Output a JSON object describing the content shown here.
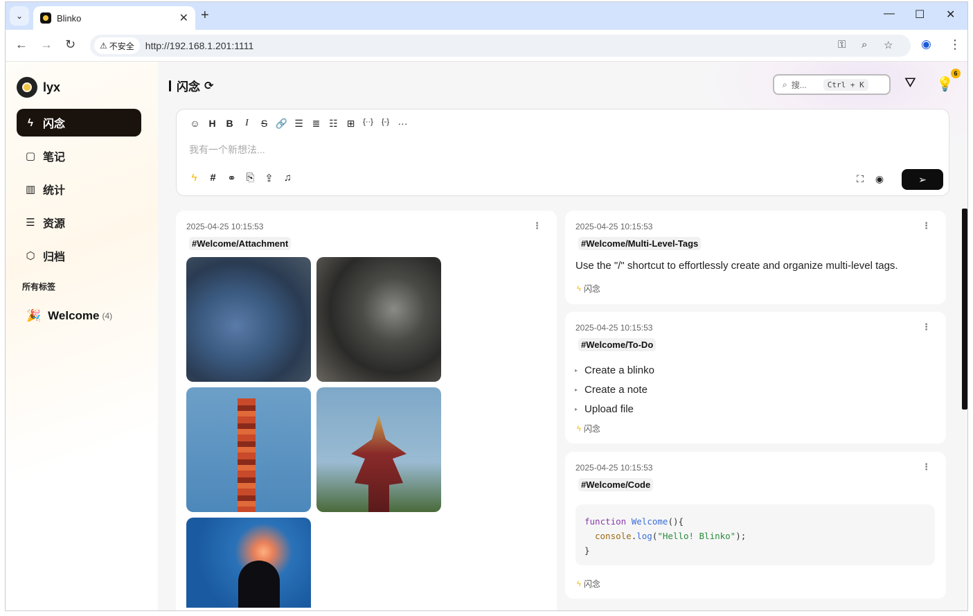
{
  "browser": {
    "tab_title": "Blinko",
    "insecure_label": "不安全",
    "url": "http://192.168.1.201:1111"
  },
  "sidebar": {
    "username": "lyx",
    "items": [
      {
        "label": "闪念",
        "icon": "flash-icon"
      },
      {
        "label": "笔记",
        "icon": "note-icon"
      },
      {
        "label": "统计",
        "icon": "chart-icon"
      },
      {
        "label": "资源",
        "icon": "database-icon"
      },
      {
        "label": "归档",
        "icon": "archive-box-icon"
      }
    ],
    "tags_title": "所有标签",
    "tag": {
      "name": "Welcome",
      "count": "(4)"
    }
  },
  "header": {
    "title": "闪念",
    "search_placeholder": "搜...",
    "shortcut_ctrl": "Ctrl",
    "shortcut_plus": "+",
    "shortcut_key": "K",
    "notification_count": "6"
  },
  "editor": {
    "placeholder": "我有一个新想法..."
  },
  "notes": [
    {
      "time": "2025-04-25 10:15:53",
      "tag": "#Welcome/Attachment"
    },
    {
      "time": "2025-04-25 10:15:53",
      "tag": "#Welcome/Multi-Level-Tags",
      "text": "Use the \"/\" shortcut to effortlessly create and organize multi-level tags.",
      "footer": "闪念"
    },
    {
      "time": "2025-04-25 10:15:53",
      "tag": "#Welcome/To-Do",
      "items": [
        "Create a blinko",
        "Create a note",
        "Upload file"
      ],
      "footer": "闪念"
    },
    {
      "time": "2025-04-25 10:15:53",
      "tag": "#Welcome/Code",
      "code": {
        "line1_kw": "function",
        "line1_fn": "Welcome",
        "line1_rest": "(){",
        "line2_obj": "console",
        "line2_dot": ".",
        "line2_fn": "log",
        "line2_open": "(",
        "line2_str": "\"Hello! Blinko\"",
        "line2_close": ");",
        "line3": "}"
      },
      "footer": "闪念"
    }
  ],
  "colors": {
    "accent": "#f6b500",
    "active_menu": "#1a120c",
    "send_button": "#0d0d0d"
  }
}
